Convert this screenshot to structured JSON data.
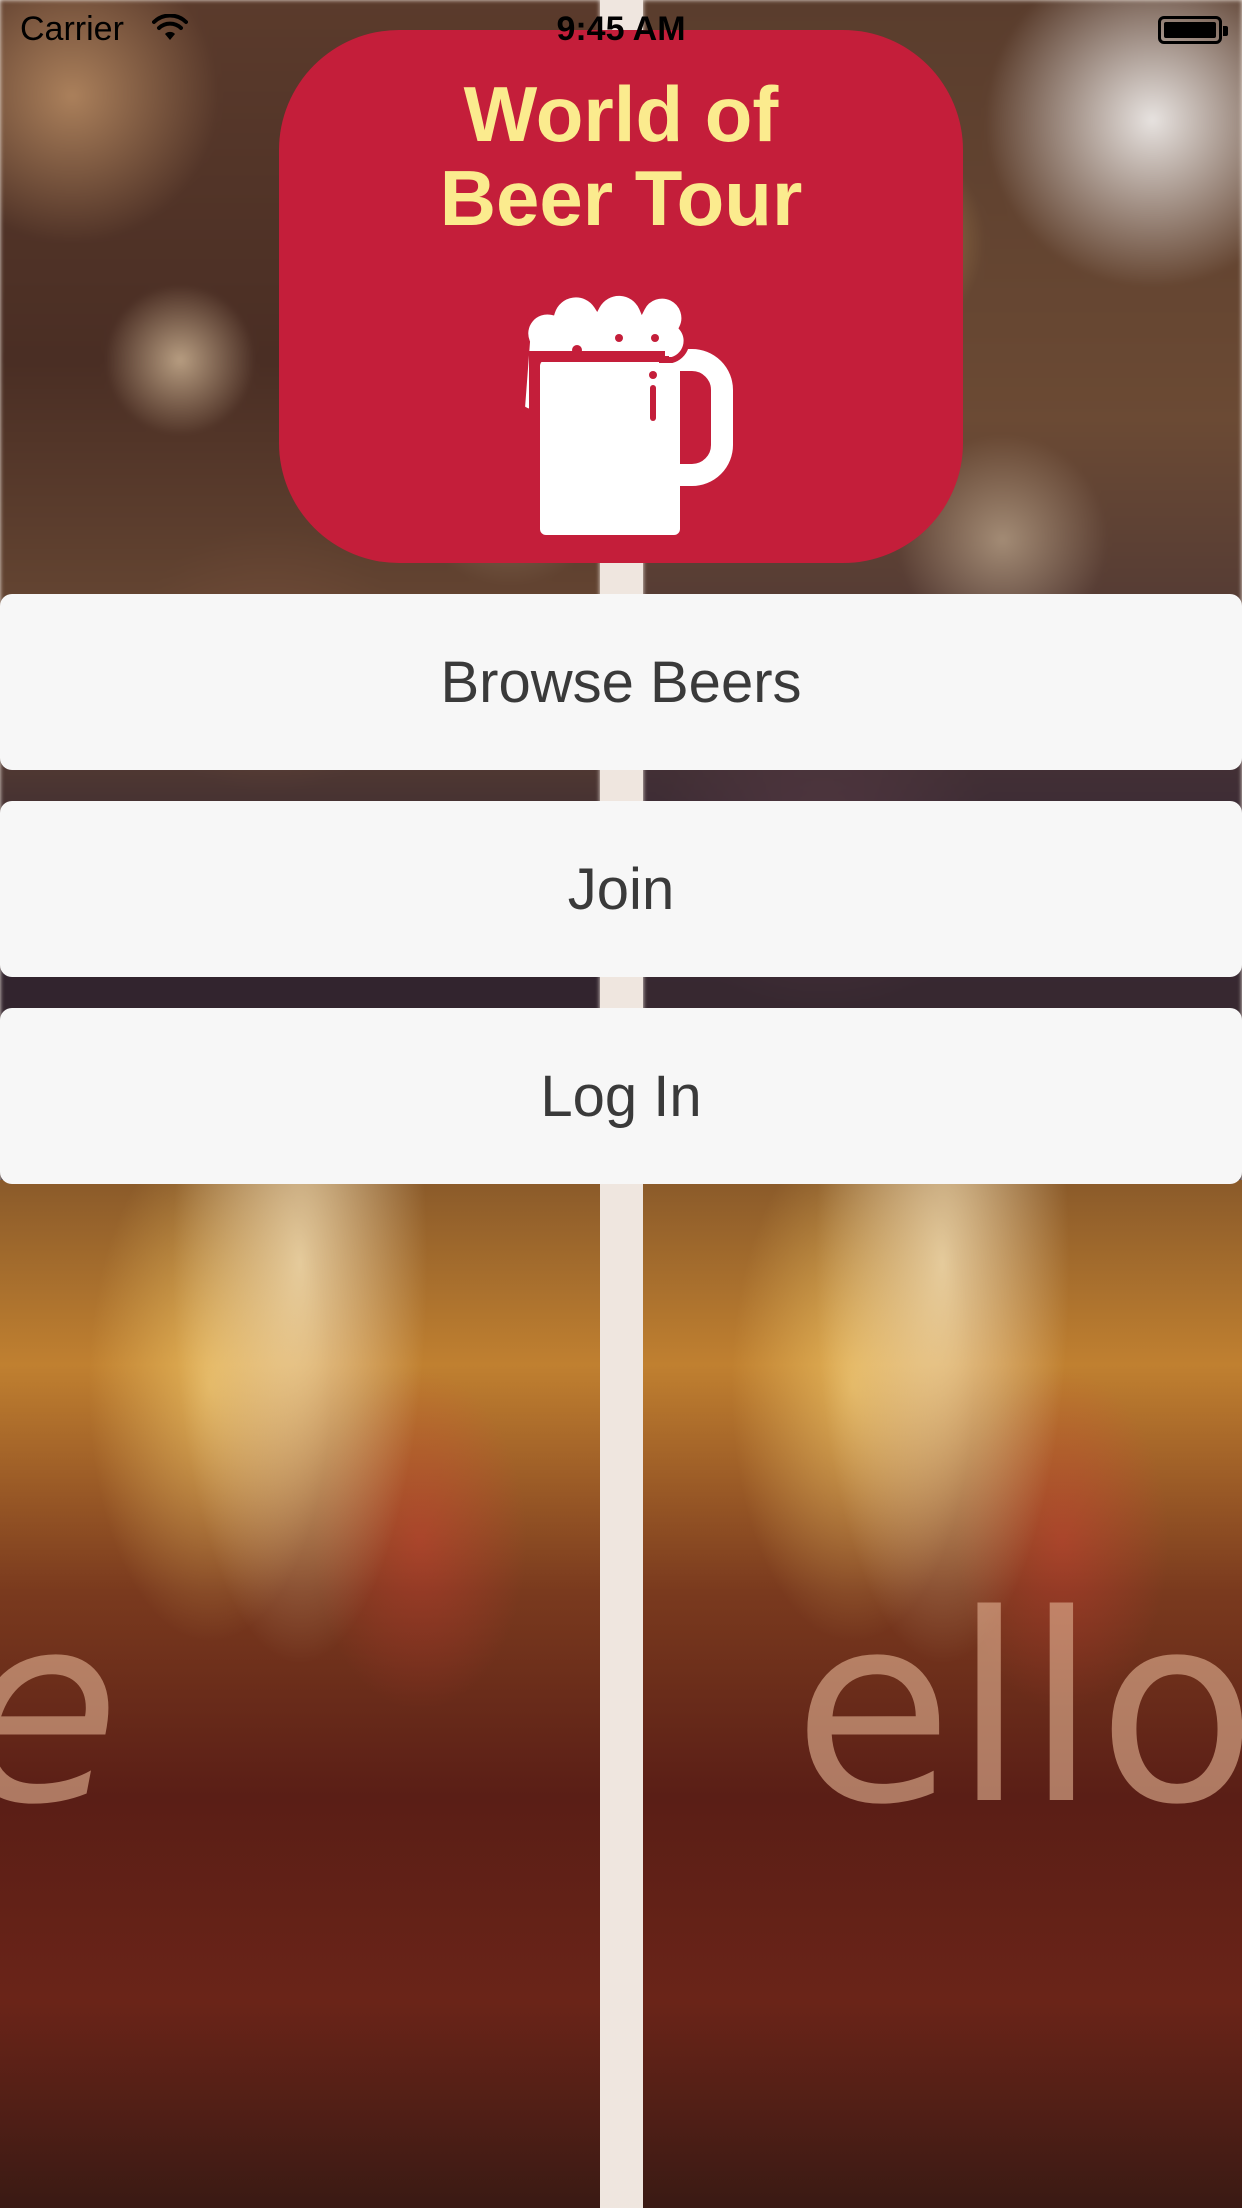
{
  "status_bar": {
    "carrier": "Carrier",
    "time": "9:45 AM",
    "wifi_icon": "wifi-icon",
    "battery_icon": "battery-icon"
  },
  "logo": {
    "title_line1": "World of",
    "title_line2": "Beer Tour",
    "icon": "beer-mug-icon",
    "card_color": "#c41e3a",
    "title_color": "#fbeb8e"
  },
  "buttons": {
    "browse_label": "Browse Beers",
    "join_label": "Join",
    "login_label": "Log In"
  },
  "background": {
    "glass_left_text": "e",
    "glass_right_text": "ello"
  }
}
